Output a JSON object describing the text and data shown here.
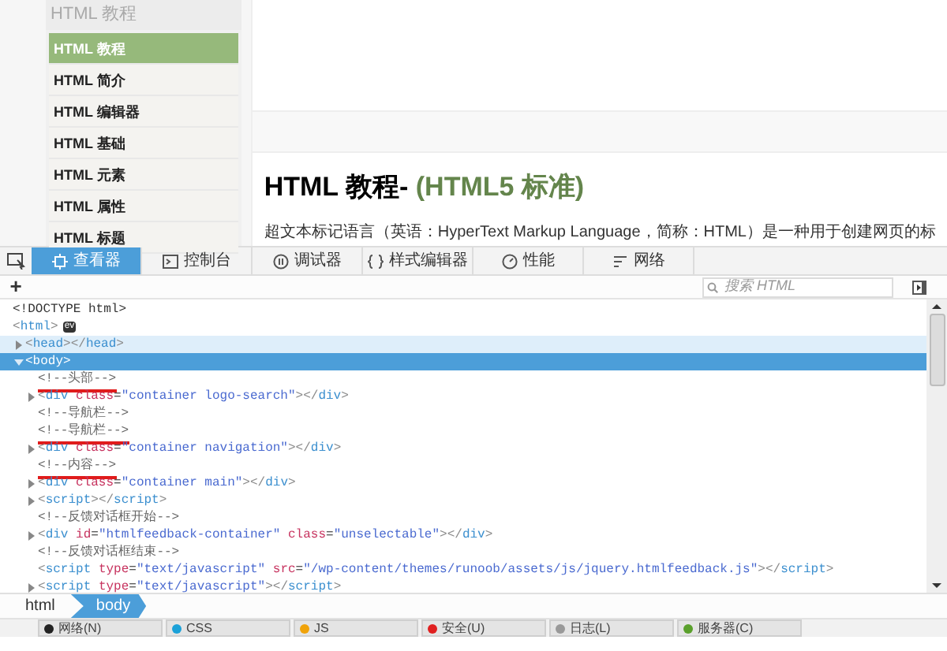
{
  "sidebar": {
    "heading": "HTML 教程",
    "items": [
      {
        "label": "HTML 教程",
        "selected": true
      },
      {
        "label": "HTML 简介",
        "selected": false
      },
      {
        "label": "HTML 编辑器",
        "selected": false
      },
      {
        "label": "HTML 基础",
        "selected": false
      },
      {
        "label": "HTML 元素",
        "selected": false
      },
      {
        "label": "HTML 属性",
        "selected": false
      },
      {
        "label": "HTML 标题",
        "selected": false
      }
    ]
  },
  "article": {
    "title": "HTML 教程-",
    "title_suffix": "(HTML5 标准)",
    "intro": "超文本标记语言（英语：HyperText Markup Language，简称：HTML）是一种用于创建网页的标"
  },
  "devtools": {
    "tabs": [
      {
        "label": "查看器",
        "selected": true
      },
      {
        "label": "控制台",
        "selected": false
      },
      {
        "label": "调试器",
        "selected": false
      },
      {
        "label": "样式编辑器",
        "selected": false
      },
      {
        "label": "性能",
        "selected": false
      },
      {
        "label": "网络",
        "selected": false
      }
    ],
    "add_button": "+",
    "search": {
      "placeholder": "搜索 HTML"
    },
    "tree": [
      {
        "kind": "doctype",
        "text": "<!DOCTYPE html>"
      },
      {
        "kind": "tag",
        "text": "<html>",
        "badge": "ev",
        "children": [
          {
            "kind": "tag",
            "text": "<head></head>",
            "expanded": false,
            "highlighted": true
          },
          {
            "kind": "tag",
            "text": "<body>",
            "expanded": true,
            "selected": true,
            "children": [
              {
                "kind": "comment",
                "text": "<!--头部-->",
                "underlined": true
              },
              {
                "kind": "tag",
                "text": "<div class=\"container logo-search\"></div>",
                "expanded": false
              },
              {
                "kind": "comment",
                "text": "<!--导航栏-->",
                "underlined": false
              },
              {
                "kind": "comment",
                "text": "<!--导航栏-->",
                "underlined": true
              },
              {
                "kind": "tag",
                "text": "<div class=\"container navigation\"></div>",
                "expanded": false
              },
              {
                "kind": "comment",
                "text": "<!--内容-->",
                "underlined": true
              },
              {
                "kind": "tag",
                "text": "<div class=\"container main\"></div>",
                "expanded": false
              },
              {
                "kind": "tag",
                "text": "<script></script>",
                "expanded": false
              },
              {
                "kind": "comment",
                "text": "<!--反馈对话框开始-->",
                "underlined": false
              },
              {
                "kind": "tag",
                "text": "<div id=\"htmlfeedback-container\" class=\"unselectable\"></div>",
                "expanded": false
              },
              {
                "kind": "comment",
                "text": "<!--反馈对话框结束-->",
                "underlined": false
              },
              {
                "kind": "tag",
                "text": "<script type=\"text/javascript\" src=\"/wp-content/themes/runoob/assets/js/jquery.htmlfeedback.js\"></script>"
              },
              {
                "kind": "tag",
                "text": "<script type=\"text/javascript\"></script>",
                "expanded": false
              }
            ]
          }
        ]
      }
    ],
    "breadcrumbs": [
      {
        "label": "html",
        "selected": false
      },
      {
        "label": "body",
        "selected": true
      }
    ],
    "filters": [
      {
        "label": "网络(N)",
        "color": "#222222"
      },
      {
        "label": "CSS",
        "color": "#1ba1d8"
      },
      {
        "label": "JS",
        "color": "#f0a30a"
      },
      {
        "label": "安全(U)",
        "color": "#e02020"
      },
      {
        "label": "日志(L)",
        "color": "#999999"
      },
      {
        "label": "服务器(C)",
        "color": "#5aa02c"
      }
    ]
  }
}
